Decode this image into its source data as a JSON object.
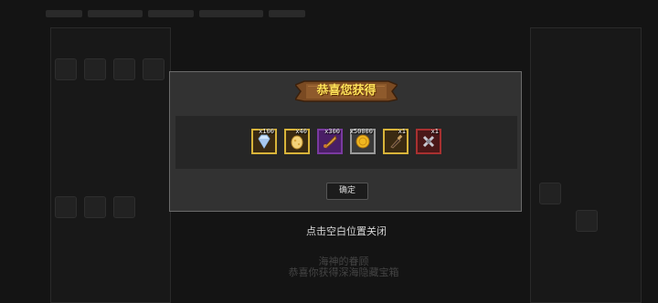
{
  "background": {
    "behind_title": "海神的眷顾",
    "behind_subtitle": "恭喜你获得深海隐藏宝箱"
  },
  "modal": {
    "title": "恭喜您获得",
    "confirm_label": "确定",
    "rewards": [
      {
        "name": "diamond-icon",
        "quantity": "x100",
        "rarity": "gold"
      },
      {
        "name": "egg-icon",
        "quantity": "x40",
        "rarity": "gold"
      },
      {
        "name": "horn-icon",
        "quantity": "x300",
        "rarity": "purple"
      },
      {
        "name": "gold-coin-icon",
        "quantity": "x50000",
        "rarity": "gray"
      },
      {
        "name": "bottle-icon",
        "quantity": "x1",
        "rarity": "gold"
      },
      {
        "name": "cross-amulet-icon",
        "quantity": "x1",
        "rarity": "red"
      }
    ]
  },
  "close_hint": "点击空白位置关闭",
  "colors": {
    "modal_bg": "#323232",
    "title_text": "#ffe35a",
    "banner_wood": "#7a4a22"
  }
}
